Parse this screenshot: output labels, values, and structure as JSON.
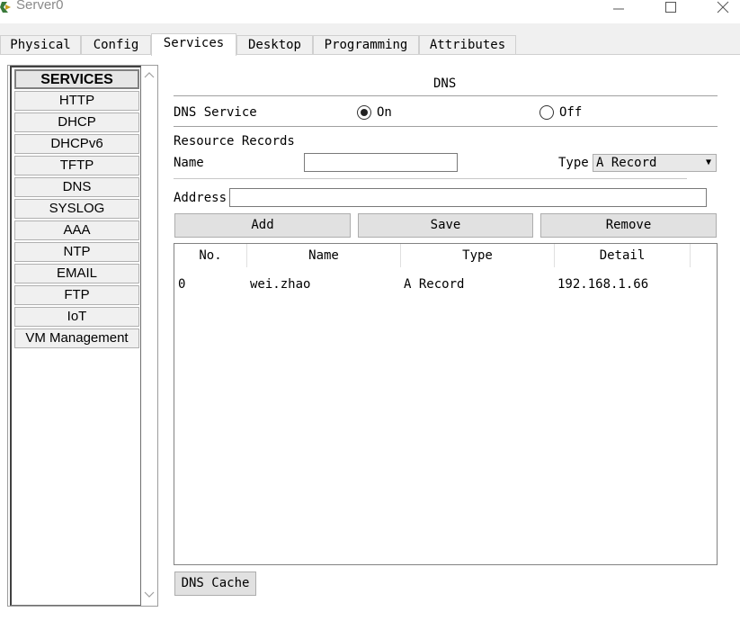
{
  "window": {
    "title": "Server0",
    "minimize_glyph": "—",
    "maximize_glyph": "☐",
    "close_glyph": "✕"
  },
  "tabs": [
    {
      "label": "Physical"
    },
    {
      "label": "Config"
    },
    {
      "label": "Services",
      "active": true
    },
    {
      "label": "Desktop"
    },
    {
      "label": "Programming"
    },
    {
      "label": "Attributes"
    }
  ],
  "sidebar": {
    "header": "SERVICES",
    "items": [
      "HTTP",
      "DHCP",
      "DHCPv6",
      "TFTP",
      "DNS",
      "SYSLOG",
      "AAA",
      "NTP",
      "EMAIL",
      "FTP",
      "IoT",
      "VM Management"
    ]
  },
  "dns": {
    "section_title": "DNS",
    "service_label": "DNS Service",
    "on_label": "On",
    "off_label": "Off",
    "service_state": "On",
    "resource_records_label": "Resource Records",
    "name_label": "Name",
    "name_value": "",
    "type_label": "Type",
    "type_value": "A Record",
    "address_label": "Address",
    "address_value": "",
    "buttons": {
      "add": "Add",
      "save": "Save",
      "remove": "Remove"
    },
    "table": {
      "columns": [
        "No.",
        "Name",
        "Type",
        "Detail"
      ],
      "rows": [
        {
          "no": "0",
          "name": "wei.zhao",
          "type": "A Record",
          "detail": "192.168.1.66"
        }
      ]
    },
    "cache_button": "DNS Cache"
  }
}
